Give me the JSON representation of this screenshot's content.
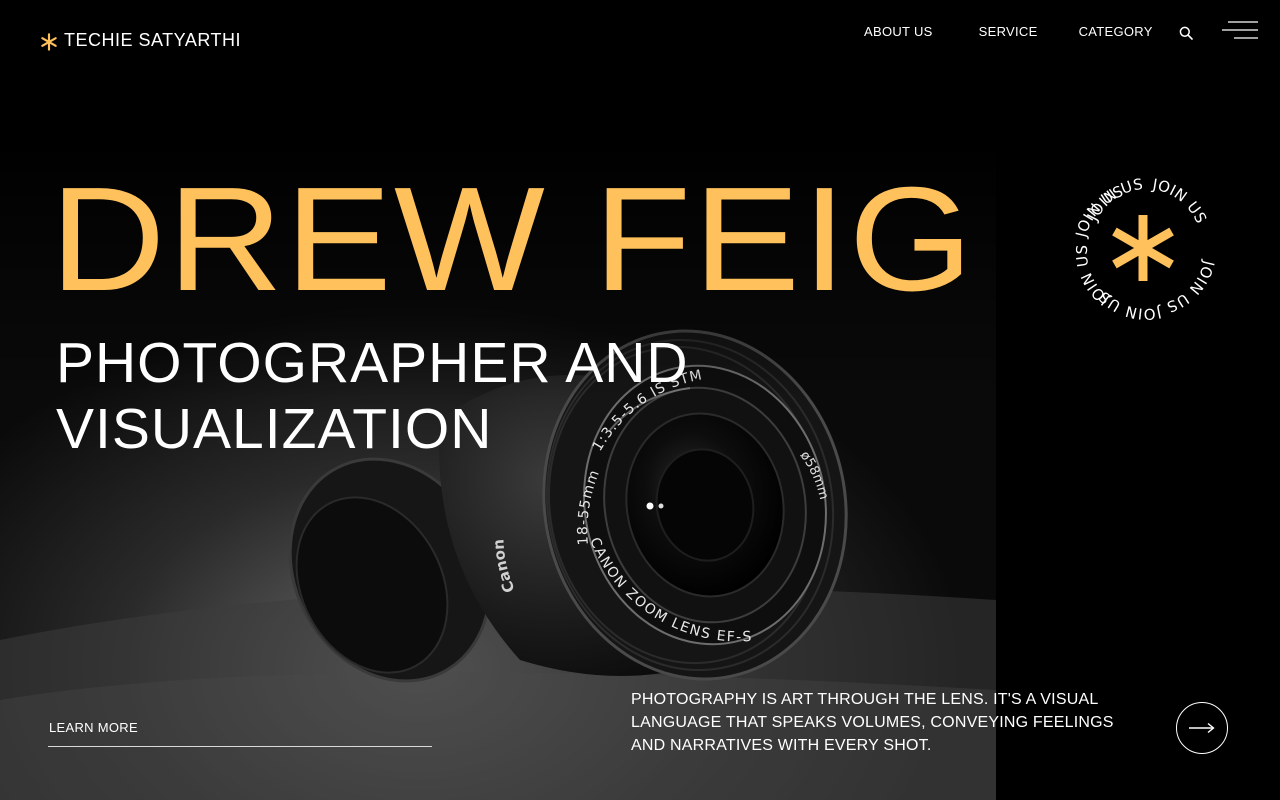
{
  "brand": {
    "name": "TECHIE SATYARTHI",
    "logo_icon": "asterisk-icon"
  },
  "nav": {
    "items": [
      {
        "label": "ABOUT US"
      },
      {
        "label": "SERVICE"
      },
      {
        "label": "CATEGORY"
      }
    ],
    "search_icon": "search-icon",
    "menu_icon": "hamburger-menu-icon"
  },
  "hero": {
    "name": "DREW FEIG",
    "subtitle_line1": "PHOTOGRAPHER AND",
    "subtitle_line2": "VISUALIZATION",
    "background": "camera-lens-photo"
  },
  "lens": {
    "top_text": "1:3.5-5.6 IS STM",
    "side_text": "18-55mm",
    "ring_text": "CANON ZOOM LENS EF-S",
    "diameter": "ø58mm",
    "body_brand": "Canon"
  },
  "badge": {
    "text": "JOIN US",
    "icon": "asterisk-icon"
  },
  "cta": {
    "learn_more": "LEARN MORE",
    "arrow_icon": "arrow-right-icon"
  },
  "description": "PHOTOGRAPHY IS ART THROUGH THE LENS. IT'S A VISUAL LANGUAGE THAT SPEAKS VOLUMES, CONVEYING FEELINGS AND NARRATIVES WITH EVERY SHOT.",
  "colors": {
    "accent": "#ffc15c",
    "background": "#000000",
    "text": "#ffffff"
  }
}
